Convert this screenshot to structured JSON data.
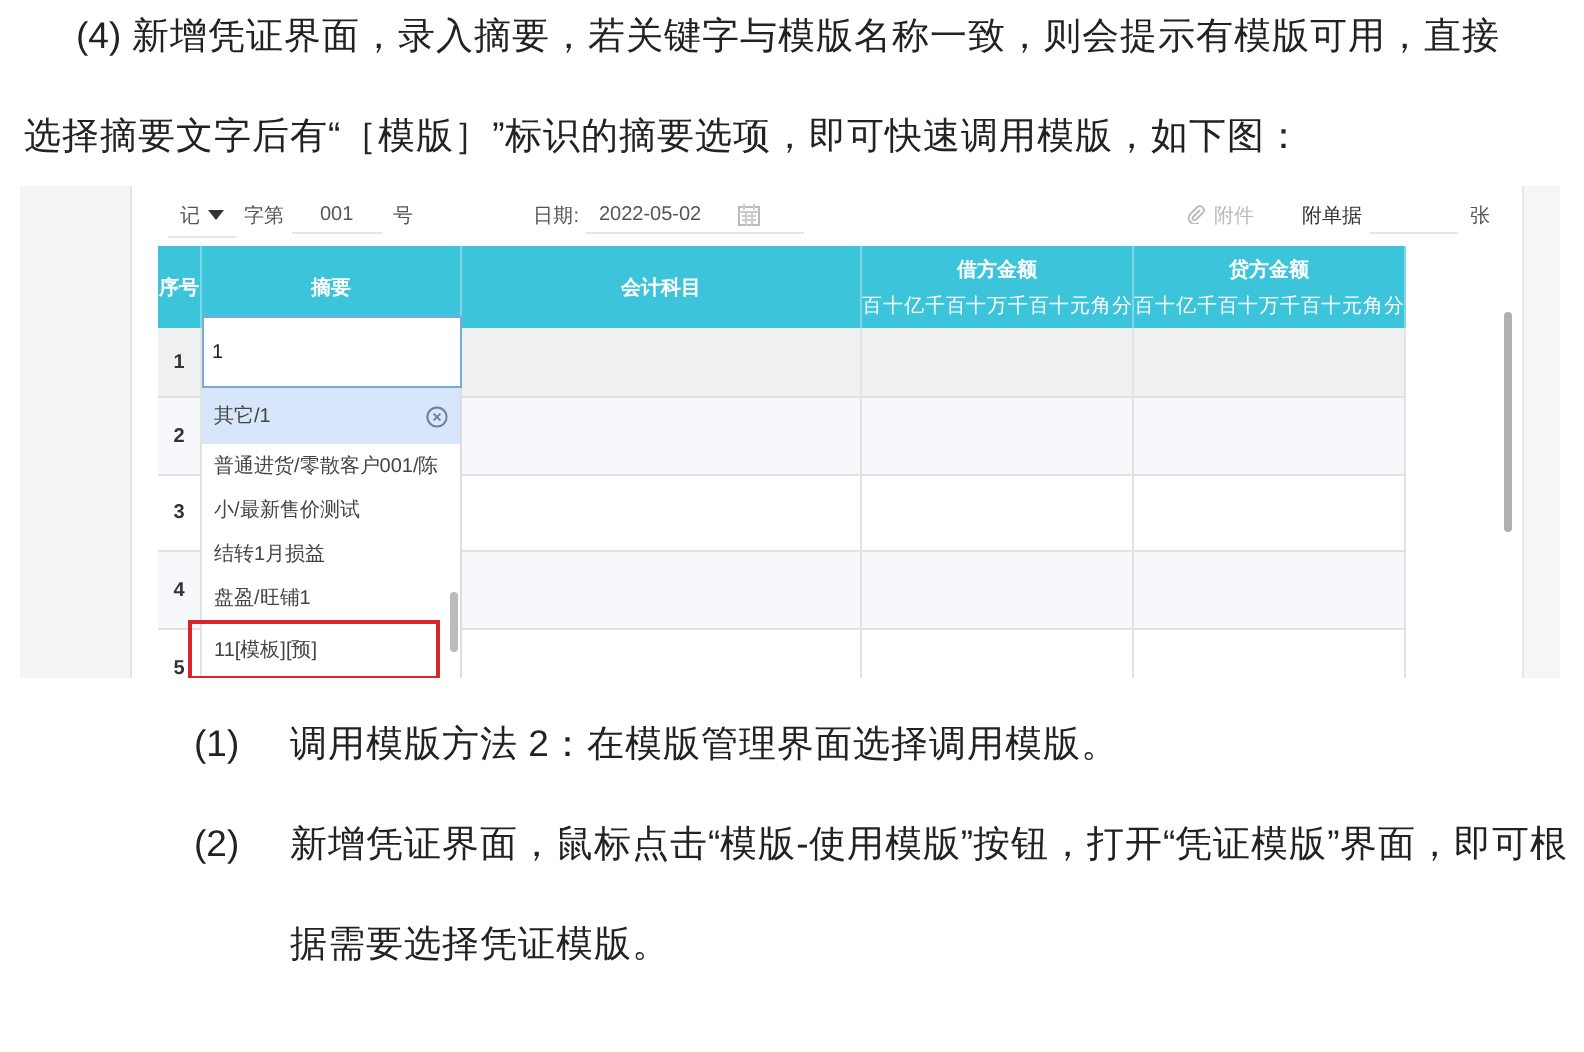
{
  "intro": "(4) 新增凭证界面，录入摘要，若关键字与模版名称一致，则会提示有模版可用，直接选择摘要文字后有“［模版］”标识的摘要选项，即可快速调用模版，如下图：",
  "voucher": {
    "type": "记",
    "number_label": "字第",
    "number": "001",
    "number_suffix": "号",
    "date_label": "日期:",
    "date": "2022-05-02",
    "attachment": "附件",
    "bills_label": "附单据",
    "bills_unit": "张"
  },
  "table": {
    "columns": [
      {
        "kind": "text",
        "label": "序号"
      },
      {
        "kind": "text",
        "label": "摘要"
      },
      {
        "kind": "text",
        "label": "会计科目"
      },
      {
        "kind": "amount",
        "label": "借方金额",
        "units": [
          "百",
          "十",
          "亿",
          "千",
          "百",
          "十",
          "万",
          "千",
          "百",
          "十",
          "元",
          "角",
          "分"
        ]
      },
      {
        "kind": "amount",
        "label": "贷方金额",
        "units": [
          "百",
          "十",
          "亿",
          "千",
          "百",
          "十",
          "万",
          "千",
          "百",
          "十",
          "元",
          "角",
          "分"
        ]
      }
    ],
    "rows": [
      {
        "number": "1",
        "active": true
      },
      {
        "number": "2",
        "active": false
      },
      {
        "number": "3",
        "active": false
      },
      {
        "number": "4",
        "active": false
      },
      {
        "number": "5",
        "active": false
      }
    ]
  },
  "summary_input": {
    "value": "1"
  },
  "summary_dropdown": {
    "items": [
      {
        "text": "其它/1",
        "selected": true,
        "annotated": false
      },
      {
        "text": "普通进货/零散客户001/陈",
        "selected": false,
        "annotated": false
      },
      {
        "text": "小/最新售价测试",
        "selected": false,
        "annotated": false
      },
      {
        "text": "结转1月损益",
        "selected": false,
        "annotated": false
      },
      {
        "text": "盘盈/旺铺1",
        "selected": false,
        "annotated": false
      },
      {
        "text": "11[模板][预]",
        "selected": false,
        "annotated": true
      }
    ]
  },
  "steps": [
    {
      "number": "(1)",
      "text": "调用模版方法 2：在模版管理界面选择调用模版。"
    },
    {
      "number": "(2)",
      "text": "新增凭证界面，鼠标点击“模版-使用模版”按钮，打开“凭证模版”界面，即可根据需要选择凭证模版。"
    }
  ]
}
